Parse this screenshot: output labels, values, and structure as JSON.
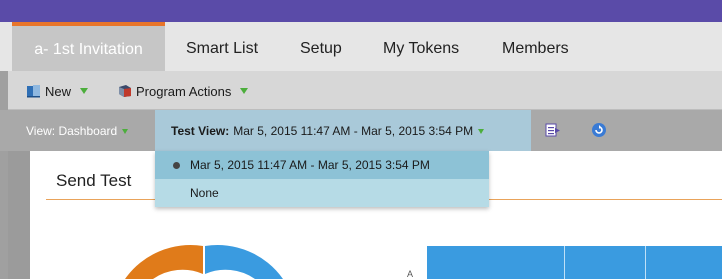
{
  "tabs": [
    {
      "label": "a- 1st Invitation",
      "active": true
    },
    {
      "label": "Smart List"
    },
    {
      "label": "Setup"
    },
    {
      "label": "My Tokens"
    },
    {
      "label": "Members"
    }
  ],
  "toolbar": {
    "new_label": "New",
    "program_actions_label": "Program Actions"
  },
  "viewbar": {
    "view_label": "View: Dashboard",
    "test_view_prefix": "Test View:",
    "test_view_value": "Mar 5, 2015 11:47 AM - Mar 5, 2015 3:54 PM"
  },
  "dropdown": {
    "options": [
      {
        "label": "Mar 5, 2015 11:47 AM - Mar 5, 2015 3:54 PM",
        "selected": true
      },
      {
        "label": "None",
        "selected": false
      }
    ]
  },
  "panel": {
    "title": "Send Test",
    "axis_label": "A"
  },
  "colors": {
    "header": "#5a4ba8",
    "tab_accent": "#e8752a",
    "dropdown_arrow": "#4cae3c",
    "chart_blue": "#3a9be0",
    "chart_orange": "#e07b1a"
  }
}
